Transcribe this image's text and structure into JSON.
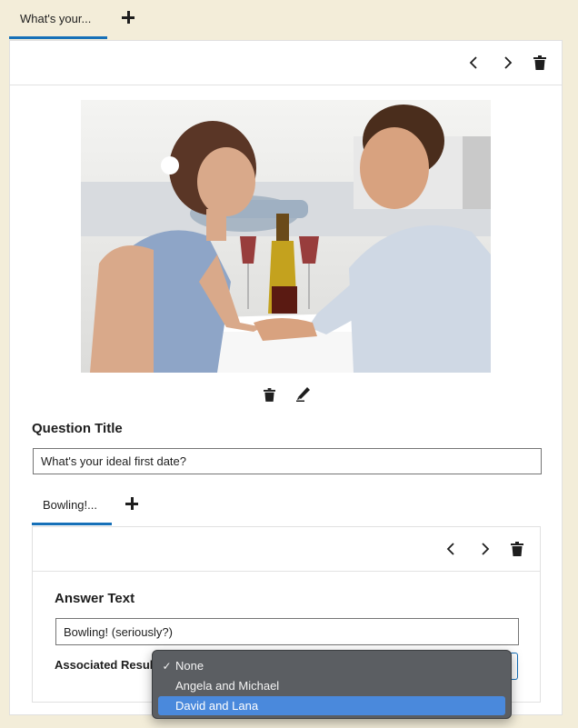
{
  "question_tabs": [
    {
      "label": "What's your..."
    }
  ],
  "answer_tabs": [
    {
      "label": "Bowling!..."
    }
  ],
  "question_title": {
    "label": "Question Title",
    "value": "What's your ideal first date?"
  },
  "answer_text": {
    "label": "Answer Text",
    "value": "Bowling! (seriously?)"
  },
  "associated_result": {
    "label": "Associated Result",
    "options": [
      {
        "label": "None",
        "checked": true
      },
      {
        "label": "Angela and Michael",
        "checked": false
      },
      {
        "label": "David and Lana",
        "checked": false
      }
    ],
    "highlighted_option": "David and Lana",
    "check_mark": "✓"
  },
  "icons": {
    "toolbar": [
      "chevron-left-icon",
      "chevron-right-icon",
      "trash-icon"
    ],
    "image_actions": [
      "trash-icon",
      "pencil-icon"
    ],
    "add_tab": "plus-icon"
  },
  "colors": {
    "accent": "#1670b8",
    "page_background": "#f3edd9",
    "dropdown_background": "#5b5e62",
    "dropdown_highlight": "#4a89dc"
  }
}
